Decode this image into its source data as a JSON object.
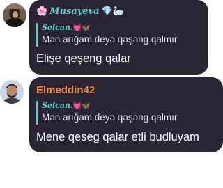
{
  "messages": [
    {
      "sender": {
        "prefix_emoji": "🌸",
        "name": "Musayeva",
        "suffix_emoji": "💎🦢",
        "color": "#5ad1c9"
      },
      "reply": {
        "name": "Selcan.",
        "emoji": "💓🦋",
        "text": "Mən arıǧam deyə qəşəng qalmır"
      },
      "text": "Elişe qeşeng qalar"
    },
    {
      "sender": {
        "name": "Elmeddin42",
        "color": "#f08a3c"
      },
      "reply": {
        "name": "Selcan.",
        "emoji": "💓🦋",
        "text": "Mən arıǧam deyə qəşəng qalmır"
      },
      "text": "Mene qeseg qalar etli budluyam"
    }
  ],
  "colors": {
    "bubble": "#2a2535",
    "accent": "#5ad1c9",
    "sender2": "#f08a3c"
  }
}
